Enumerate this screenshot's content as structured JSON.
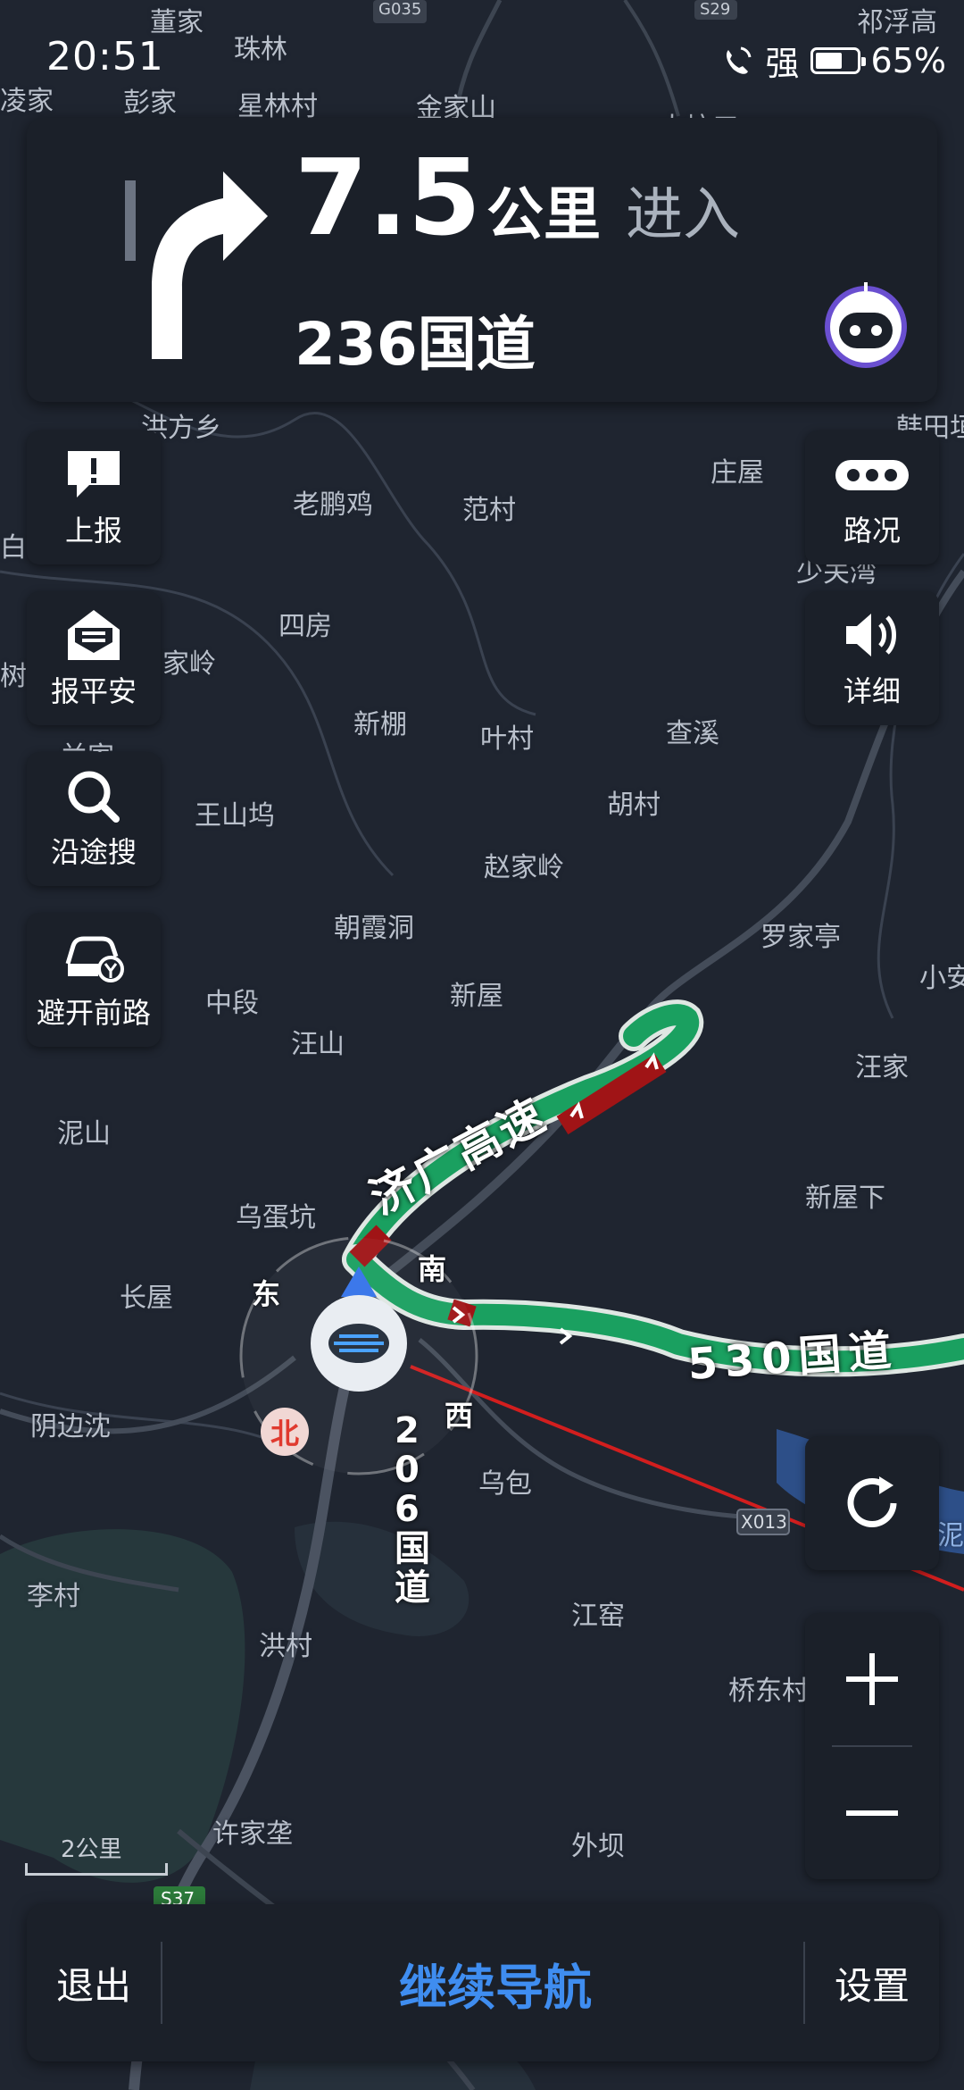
{
  "status_bar": {
    "time": "20:51",
    "signal": "强",
    "battery": "65%",
    "battery_level": 0.65
  },
  "guidance": {
    "distance": "7.5",
    "unit": "公里",
    "action": "进入",
    "road": "236国道"
  },
  "side_buttons": {
    "report": "上报",
    "safety": "报平安",
    "search_along": "沿途搜",
    "avoid": "避开前路",
    "traffic": "路况",
    "detail": "详细"
  },
  "map": {
    "places": [
      "董家",
      "珠林",
      "祁浮高",
      "凌家",
      "彭家",
      "星林村",
      "金家山",
      "大坑口",
      "洪方乡",
      "韩田垣",
      "老鹏鸡",
      "范村",
      "庄屋",
      "白",
      "少关湾",
      "四房",
      "家岭",
      "树",
      "新棚",
      "叶村",
      "查溪",
      "兰家",
      "王山坞",
      "胡村",
      "赵家岭",
      "朝霞洞",
      "罗家亭",
      "中段",
      "新屋",
      "小安",
      "汪山",
      "汪家",
      "泥山",
      "新屋下",
      "乌蛋坑",
      "长屋",
      "阴边沈",
      "乌包",
      "李村",
      "洪村",
      "江窑",
      "桥东村",
      "许家垄",
      "外坝",
      "泥"
    ],
    "road_labels": [
      "济广高速",
      "530国道",
      "206国道"
    ],
    "road_codes": [
      "G035",
      "S29",
      "X013",
      "S37"
    ],
    "compass": {
      "north": "北",
      "south": "南",
      "east": "东",
      "west": "西"
    },
    "scale": "2公里"
  },
  "bottom_bar": {
    "exit": "退出",
    "continue": "继续导航",
    "settings": "设置"
  },
  "colors": {
    "route_green": "#1aa060",
    "route_red": "#a01416",
    "accent_blue": "#3f8df0",
    "card_bg": "#1b2029",
    "map_bg": "#1f2530"
  }
}
